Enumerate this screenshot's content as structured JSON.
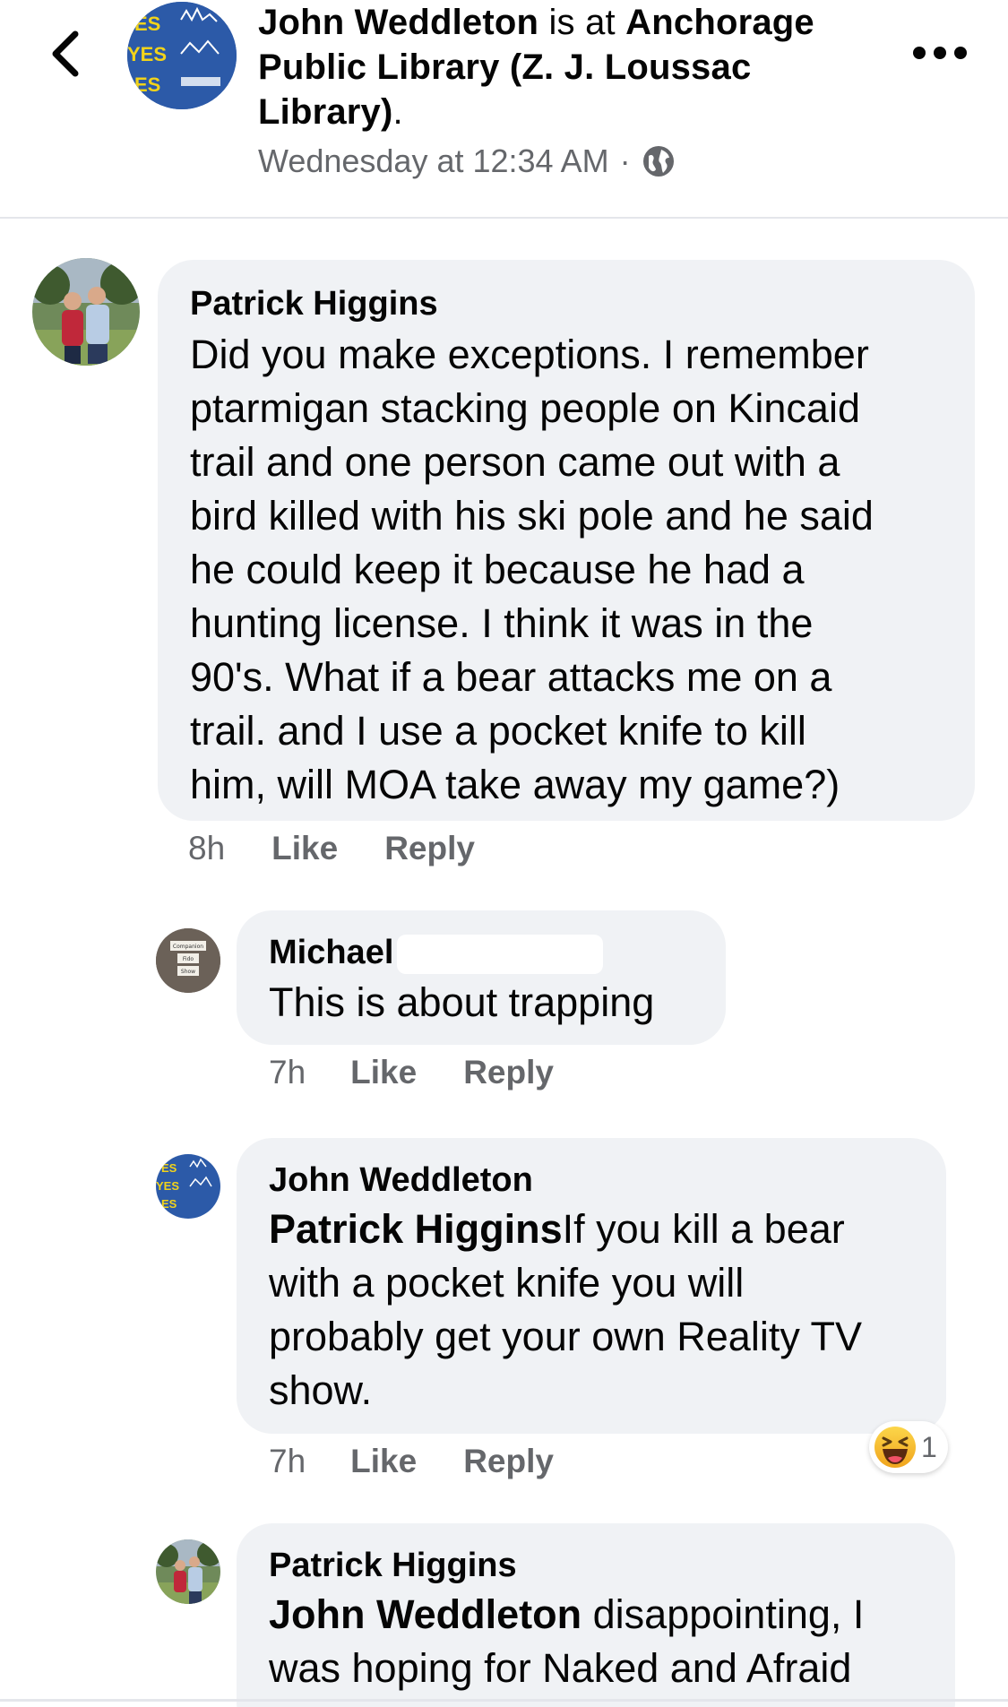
{
  "header": {
    "page_name": "John Weddleton",
    "connector": " is at ",
    "place_line1": "Anchorage",
    "place_line2": "Public Library (Z. J. Loussac",
    "place_line3": "Library)",
    "suffix": ".",
    "timestamp": "Wednesday at 12:34 AM",
    "separator": "·",
    "avatar_text": [
      "ES",
      "YES",
      "ES"
    ]
  },
  "comments": [
    {
      "author": "Patrick Higgins",
      "lines": [
        "Did you make exceptions.   I remember",
        "ptarmigan stacking people on Kincaid",
        "trail and one person came out with a",
        "bird killed with his ski pole and he said",
        "he could keep it because he had a",
        "hunting license.  I think it was in the",
        "90's.  What if a bear attacks me on a",
        "trail. and I use a pocket knife to kill",
        "him,  will MOA take away my game?)"
      ],
      "time": "8h",
      "like": "Like",
      "reply": "Reply"
    },
    {
      "author": "Michael",
      "lines": [
        "This is about trapping"
      ],
      "avatar_text": [
        "Companion",
        "Fido",
        "Show"
      ],
      "time": "7h",
      "like": "Like",
      "reply": "Reply"
    },
    {
      "author": "John Weddleton",
      "mention": "Patrick Higgins",
      "lines": [
        "If you kill a bear",
        "with a pocket knife you will",
        "probably get your own Reality TV",
        "show."
      ],
      "time": "7h",
      "like": "Like",
      "reply": "Reply",
      "reaction_count": "1"
    },
    {
      "author": "Patrick Higgins",
      "mention": "John Weddleton",
      "lines": [
        " disappointing,  I",
        "was hoping for Naked and Afraid"
      ]
    }
  ],
  "colors": {
    "bubble": "#f0f2f5",
    "secondary_text": "#65676b",
    "primary_text": "#050505",
    "page_avatar_blue": "#2c5aa8",
    "yes_yellow": "#f2d31a"
  }
}
